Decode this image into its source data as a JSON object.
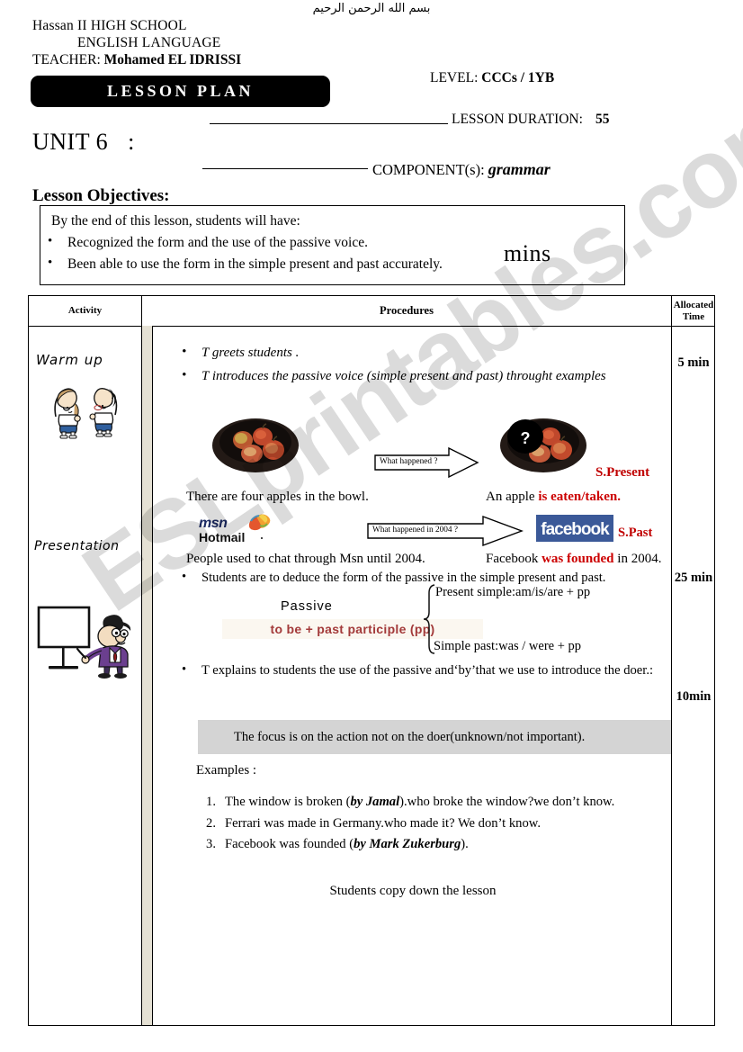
{
  "header": {
    "bismillah": "بسم الله الرحمن الرحيم",
    "school": "Hassan II HIGH SCHOOL",
    "subject": "ENGLISH LANGUAGE",
    "teacher_label": "TEACHER:",
    "teacher_name": "Mohamed EL IDRISSI",
    "banner": "LESSON PLAN",
    "level_label": "LEVEL:",
    "level_value": "CCCs / 1YB",
    "duration_label": "LESSON DURATION:",
    "duration_value": "55",
    "duration_unit": "mins",
    "unit_label": "UNIT 6",
    "unit_colon": ":",
    "component_label": "COMPONENT(s):",
    "component_value": "grammar"
  },
  "objectives": {
    "title": "Lesson Objectives:",
    "intro": "By the end of this lesson, students will have:",
    "items": [
      "Recognized the form and the use of the passive voice.",
      "Been able to use the form in the simple present and past accurately."
    ]
  },
  "table": {
    "headers": {
      "activity": "Activity",
      "procedures": "Procedures",
      "time_line1": "Allocated",
      "time_line2": "Time"
    },
    "activity": {
      "warm_up": "Warm up",
      "presentation": "Presentation"
    },
    "times": [
      "5 min",
      "25 min",
      "10min"
    ],
    "procedures": {
      "bullet_1": "T greets students .",
      "bullet_2": "T introduces the passive voice (simple present and past) throught examples",
      "bullet_3": "Students are to deduce the form of the passive in the simple present and past.",
      "bullet_4": "T explains to students the use of  the passive and‘by’that we use to introduce the doer.:",
      "callout_1": "What happened ?",
      "callout_2": "What happened in 2004 ?",
      "tense_present": "S.Present",
      "tense_past": "S.Past",
      "caption_apples_before": "There are four apples in the bowl.",
      "caption_apples_after_plain": "An apple ",
      "caption_apples_after_red": "is eaten/taken.",
      "caption_msn": "People used to chat  through Msn until 2004.",
      "caption_fb_pre": "Facebook ",
      "caption_fb_red": "was founded",
      "caption_fb_post": " in 2004.",
      "question_mark": "?",
      "logo_msn_top": "msn",
      "logo_msn_bottom": "Hotmail",
      "logo_facebook": "facebook",
      "passive_label": "Passive",
      "passive_formula": "to be  +  past participle (pp)",
      "present_simple_rule": "Present simple:am/is/are + pp",
      "past_simple_rule": "Simple past:was / were + pp",
      "focus_text": "The focus is on the action not on the doer(unknown/not important).",
      "examples_label": "Examples :",
      "examples": [
        {
          "num": "1.",
          "pre": "The window is broken (",
          "bold": "by Jamal",
          "post": ").who broke the window?we don’t know."
        },
        {
          "num": "2.",
          "pre": "Ferrari was made in Germany.who made it? We don’t know.",
          "bold": "",
          "post": ""
        },
        {
          "num": "3.",
          "pre": "Facebook was founded (",
          "bold": "by Mark Zukerburg",
          "post": ")."
        }
      ],
      "copy_line": "Students copy down the lesson"
    }
  },
  "watermark": {
    "text": "ESLprintables.com"
  },
  "colors": {
    "accent_red": "#cc0000",
    "facebook_blue": "#3b5998",
    "msn_navy": "#1b2a63",
    "passive_maroon": "#a33a3a",
    "focus_bar_grey": "#d4d4d4",
    "beige_strip": "#e5e1d4"
  }
}
